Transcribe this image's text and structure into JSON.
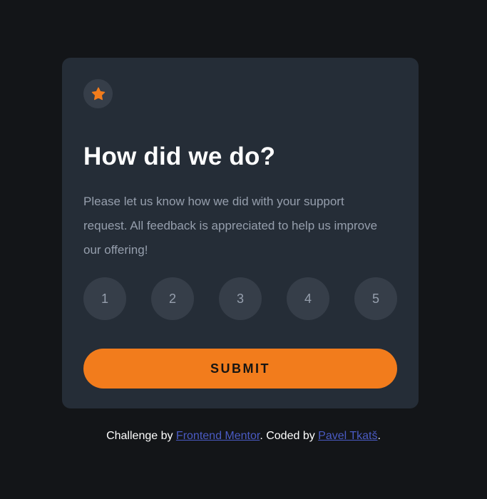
{
  "card": {
    "icon": "star-icon",
    "title": "How did we do?",
    "description": "Please let us know how we did with your support request. All feedback is appreciated to help us improve our offering!",
    "ratings": [
      "1",
      "2",
      "3",
      "4",
      "5"
    ],
    "submit_label": "SUBMIT"
  },
  "attribution": {
    "prefix": "Challenge by ",
    "link1": "Frontend Mentor",
    "middle": ". Coded by ",
    "link2": "Pavel Tkatš",
    "suffix": "."
  },
  "colors": {
    "background": "#131518",
    "card": "#252d37",
    "accent": "#f27c1c",
    "muted_text": "#969fad",
    "link": "#4a5bc4"
  }
}
